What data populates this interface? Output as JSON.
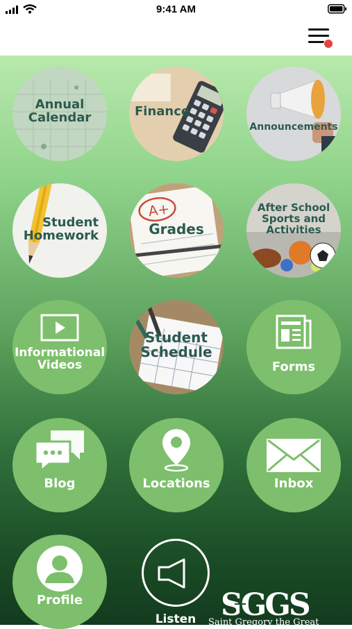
{
  "status_bar": {
    "time": "9:41 AM"
  },
  "header": {
    "menu_icon": "hamburger-menu-icon",
    "notification_color": "#e4463f"
  },
  "tiles": [
    {
      "label": "Annual\nCalendar",
      "kind": "photo",
      "icon": "calendar-photo"
    },
    {
      "label": "Finance",
      "kind": "photo",
      "icon": "calculator-photo"
    },
    {
      "label": "Announcements",
      "kind": "photo",
      "icon": "megaphone-photo"
    },
    {
      "label": "Student\nHomework",
      "kind": "photo",
      "icon": "pencil-photo"
    },
    {
      "label": "Grades",
      "kind": "photo",
      "icon": "graded-paper-photo"
    },
    {
      "label": "After School\nSports and\nActivities",
      "kind": "photo",
      "icon": "sports-balls-photo"
    },
    {
      "label": "Informational\nVideos",
      "kind": "icon",
      "icon": "video-icon"
    },
    {
      "label": "Student\nSchedule",
      "kind": "photo",
      "icon": "planner-photo"
    },
    {
      "label": "Forms",
      "kind": "icon",
      "icon": "forms-icon"
    },
    {
      "label": "Blog",
      "kind": "icon",
      "icon": "chat-bubbles-icon"
    },
    {
      "label": "Locations",
      "kind": "icon",
      "icon": "location-pin-icon"
    },
    {
      "label": "Inbox",
      "kind": "icon",
      "icon": "envelope-icon"
    },
    {
      "label": "Profile",
      "kind": "icon",
      "icon": "user-profile-icon"
    }
  ],
  "listen": {
    "label": "Listen",
    "icon": "speaker-icon"
  },
  "logo": {
    "text": "SGGS",
    "subtitle": "Saint Gregory the Great"
  },
  "colors": {
    "tile_green": "#7dbf6c",
    "label_teal": "#2c5a4f"
  }
}
